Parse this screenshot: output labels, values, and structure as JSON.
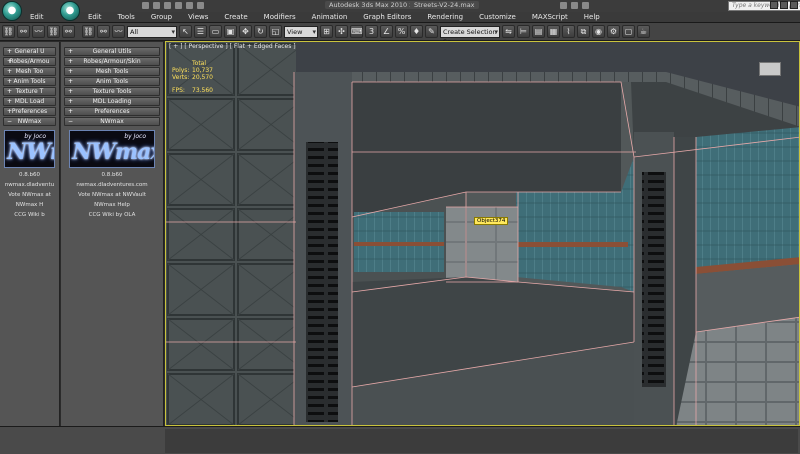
{
  "window_back": {
    "menu": [
      "Edit"
    ]
  },
  "window_front": {
    "title": "Autodesk 3ds Max 2010 x64",
    "file": "Streets-V2-24.max",
    "search_placeholder": "Type a keyword or phrase",
    "menu": [
      "Edit",
      "Tools",
      "Group",
      "Views",
      "Create",
      "Modifiers",
      "Animation",
      "Graph Editors",
      "Rendering",
      "Customize",
      "MAXScript",
      "Help"
    ]
  },
  "toolbar": {
    "selection_filter": "All",
    "ref_coord": "View",
    "named_selection": "Create Selection Se"
  },
  "panel_back": {
    "rows": [
      "General U",
      "Robes/Armou",
      "Mesh Too",
      "Anim Tools",
      "Texture T",
      "MDL Load",
      "Preferences",
      "NWmax"
    ],
    "version": "0.8.b60",
    "site": "nwmax.dladventu",
    "vote": "Vote NWmax at",
    "help": "NWmax H",
    "wiki": "CCG Wiki b"
  },
  "panel_front": {
    "rows": [
      "General Utils",
      "Robes/Armour/Skin",
      "Mesh Tools",
      "Anim Tools",
      "Texture Tools",
      "MDL Loading",
      "Preferences",
      "NWmax"
    ],
    "logo_by": "by Joco",
    "logo_text": "NWmax",
    "version": "0.8.b60",
    "site": "nwmax.dladventures.com",
    "vote": "Vote NWmax at NWVault",
    "help": "NWmax Help",
    "wiki": "CCG Wiki by OLA"
  },
  "viewport": {
    "label": "[ + ] [ Perspective ] [ Flat + Edged Faces ]",
    "stats_header": "Total",
    "stats": [
      {
        "key": "Polys:",
        "value": "10,737"
      },
      {
        "key": "Verts:",
        "value": "20,570"
      }
    ],
    "fps_key": "FPS:",
    "fps_value": "73.560",
    "object_tag": "Object374"
  },
  "colors": {
    "viewport_border": "#c9c33d",
    "stats_text": "#ffe15a",
    "wire": "#e7a9a9"
  }
}
